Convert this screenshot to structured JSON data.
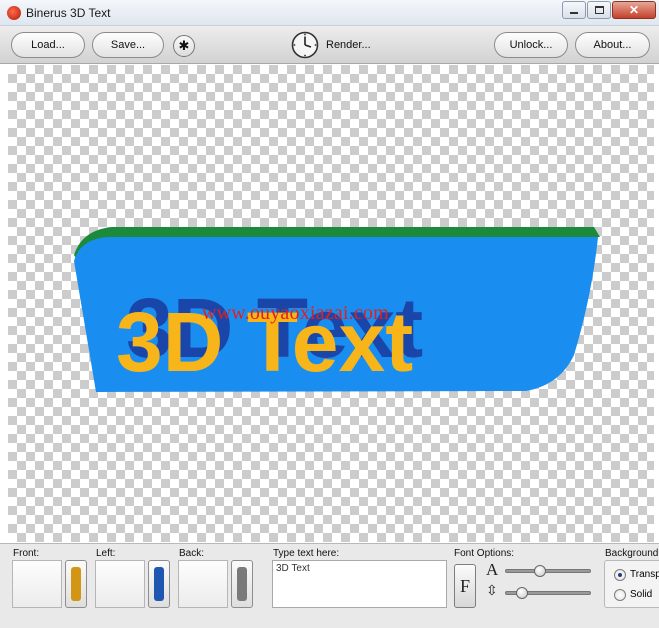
{
  "window": {
    "title": "Binerus 3D Text"
  },
  "toolbar": {
    "load_label": "Load...",
    "save_label": "Save...",
    "render_label": "Render...",
    "unlock_label": "Unlock...",
    "about_label": "About..."
  },
  "preview": {
    "text": "3D Text",
    "watermark": "www.ouyaoxiazai.com",
    "colors": {
      "face": "#1a8ef0",
      "top": "#1c8a3a",
      "text": "#f7b51a",
      "text_shadow": "#1a3a9e"
    }
  },
  "panel": {
    "front_label": "Front:",
    "left_label": "Left:",
    "back_label": "Back:",
    "type_label": "Type text here:",
    "text_value": "3D Text",
    "font_options_label": "Font Options:",
    "font_button": "F",
    "size_icon": "A",
    "depth_icon": "⇳",
    "background_label": "Background",
    "bg_option_1": "Transparent",
    "bg_option_2": "Solid",
    "front_color": "#d39514",
    "left_color": "#1f56b0",
    "back_color": "#7a7a7a",
    "size_slider_fraction": 0.38,
    "depth_slider_fraction": 0.14
  }
}
